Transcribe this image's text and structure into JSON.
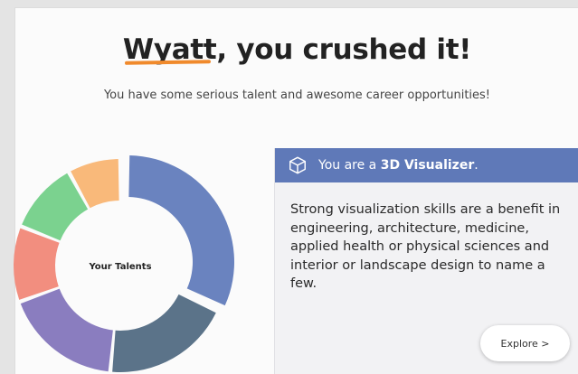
{
  "headline": {
    "name": "Wyatt",
    "rest": ", you crushed it!"
  },
  "subline": "You have some serious talent and awesome career opportunities!",
  "talents_chart": {
    "center_label": "Your Talents",
    "segments": [
      {
        "share": 0.32,
        "color": "#6a83bf"
      },
      {
        "share": 0.195,
        "color": "#5b7389"
      },
      {
        "share": 0.18,
        "color": "#8a7dbf"
      },
      {
        "share": 0.115,
        "color": "#f28e7f"
      },
      {
        "share": 0.11,
        "color": "#7bd28f"
      },
      {
        "share": 0.08,
        "color": "#f9b97a"
      }
    ]
  },
  "result_card": {
    "icon": "cube-icon",
    "prefix": "You are a ",
    "talent": "3D Visualizer",
    "suffix": ".",
    "description": "Strong visualization skills are a benefit in engineering, architecture, medicine, applied health or physical sciences and interior or landscape design to name a few.",
    "button_label": "Explore >",
    "header_color": "#5f79b8"
  }
}
